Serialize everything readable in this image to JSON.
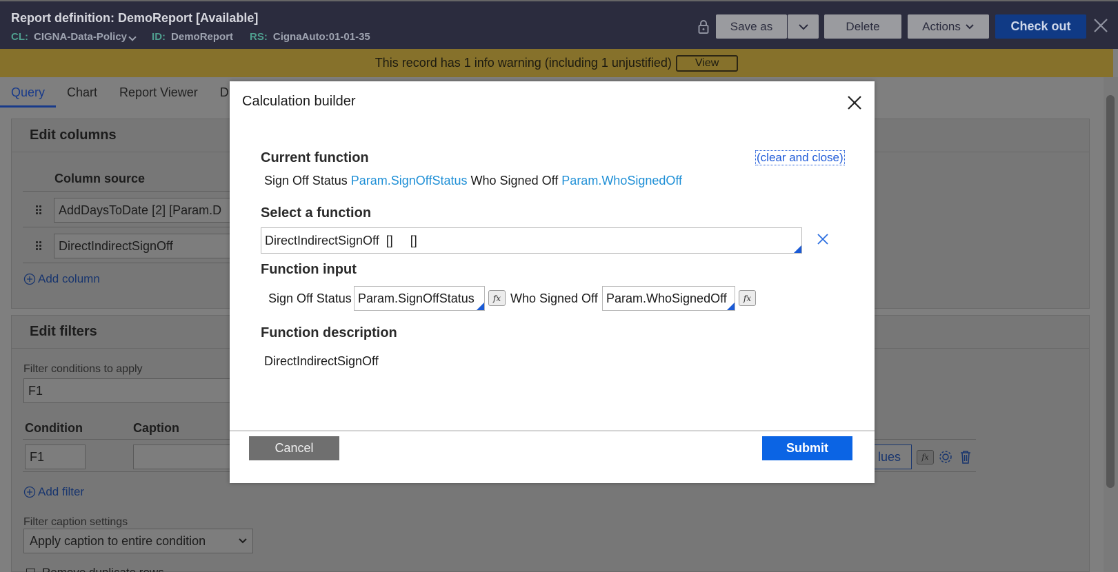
{
  "header": {
    "title": "Report definition: DemoReport [Available]",
    "cl_label": "CL:",
    "cl_value": "CIGNA-Data-Policy",
    "id_label": "ID:",
    "id_value": "DemoReport",
    "rs_label": "RS:",
    "rs_value": "CignaAuto:01-01-35",
    "buttons": {
      "save_as": "Save as",
      "delete": "Delete",
      "actions": "Actions",
      "check_out": "Check out"
    }
  },
  "warning": {
    "text": "This record has 1 info warning (including 1 unjustified)",
    "view_label": "View"
  },
  "tabs": [
    "Query",
    "Chart",
    "Report Viewer",
    "D"
  ],
  "edit_columns": {
    "heading": "Edit columns",
    "column_source_header": "Column source",
    "rows": [
      "AddDaysToDate   [2]   [Param.D",
      "DirectIndirectSignOff"
    ],
    "add_column": "Add column"
  },
  "edit_filters": {
    "heading": "Edit filters",
    "conditions_label": "Filter conditions to apply",
    "conditions_value": "F1",
    "condition_header": "Condition",
    "caption_header": "Caption",
    "row_condition": "F1",
    "values_button_fragment": "lues",
    "add_filter": "Add filter",
    "caption_settings_label": "Filter caption settings",
    "caption_settings_value": "Apply caption to entire condition",
    "remove_duplicates": "Remove duplicate rows"
  },
  "modal": {
    "title": "Calculation builder",
    "current_function_heading": "Current function",
    "clear_and_close": "(clear and close)",
    "current_function": {
      "label1": "Sign Off Status",
      "param1": "Param.SignOffStatus",
      "label2": "Who Signed Off",
      "param2": "Param.WhoSignedOff"
    },
    "select_function_heading": "Select a function",
    "select_function_value": "DirectIndirectSignOff  []     []",
    "function_input_heading": "Function input",
    "inputs": [
      {
        "label": "Sign Off Status",
        "value": "Param.SignOffStatus"
      },
      {
        "label": "Who Signed Off",
        "value": "Param.WhoSignedOff"
      }
    ],
    "fx_label": "fx",
    "function_description_heading": "Function description",
    "function_description": "DirectIndirectSignOff",
    "cancel_label": "Cancel",
    "submit_label": "Submit"
  },
  "colors": {
    "header_bg": "#2b2c3e",
    "warning_bg": "#86712b",
    "primary_button": "#0b64e4",
    "link_blue": "#1e8fd6"
  }
}
